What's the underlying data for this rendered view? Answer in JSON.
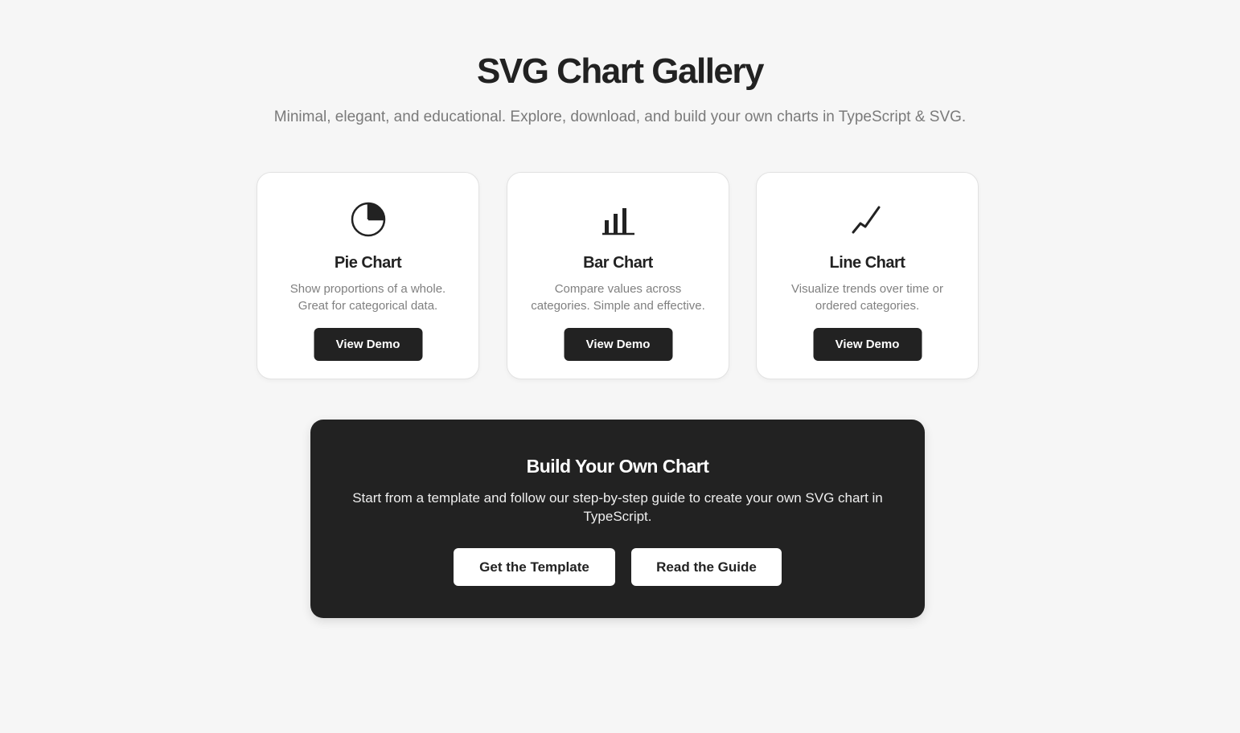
{
  "header": {
    "title": "SVG Chart Gallery",
    "subtitle": "Minimal, elegant, and educational. Explore, download, and build your own charts in TypeScript & SVG."
  },
  "cards": [
    {
      "icon": "pie-chart-icon",
      "title": "Pie Chart",
      "description": "Show proportions of a whole. Great for categorical data.",
      "button_label": "View Demo"
    },
    {
      "icon": "bar-chart-icon",
      "title": "Bar Chart",
      "description": "Compare values across categories. Simple and effective.",
      "button_label": "View Demo"
    },
    {
      "icon": "line-chart-icon",
      "title": "Line Chart",
      "description": "Visualize trends over time or ordered categories.",
      "button_label": "View Demo"
    }
  ],
  "cta": {
    "title": "Build Your Own Chart",
    "description": "Start from a template and follow our step-by-step guide to create your own SVG chart in TypeScript.",
    "template_button_label": "Get the Template",
    "guide_button_label": "Read the Guide"
  },
  "colors": {
    "background": "#f6f6f6",
    "card": "#ffffff",
    "dark": "#222222",
    "muted_text": "#808080"
  }
}
